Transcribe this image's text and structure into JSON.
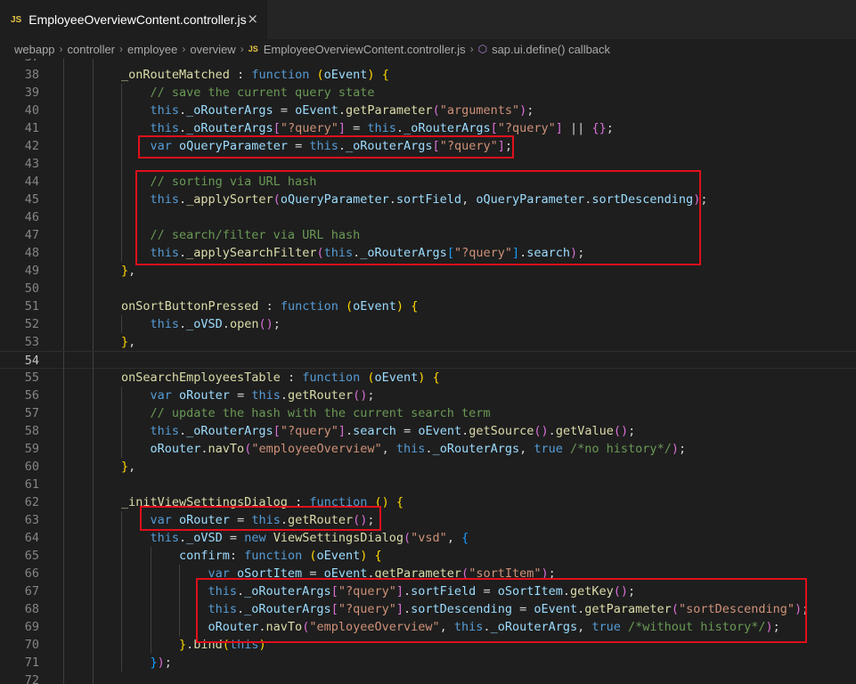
{
  "tab": {
    "badge": "JS",
    "title": "EmployeeOverviewContent.controller.js",
    "close_icon": "×"
  },
  "breadcrumb": {
    "segments": [
      "webapp",
      "controller",
      "employee",
      "overview"
    ],
    "file_badge": "JS",
    "file": "EmployeeOverviewContent.controller.js",
    "symbol": "sap.ui.define() callback"
  },
  "colors": {
    "keyword": "#569cd6",
    "function_name": "#dcdcaa",
    "variable": "#9cdcfe",
    "string": "#ce9178",
    "comment": "#6a9955",
    "highlight_box": "#e00f1c"
  },
  "editor": {
    "lines": [
      {
        "num": "37",
        "indent": 2,
        "tokens": [],
        "partial": true
      },
      {
        "num": "38",
        "indent": 2,
        "tokens": [
          [
            "fn",
            "_onRouteMatched"
          ],
          [
            "p",
            " : "
          ],
          [
            "k",
            "function"
          ],
          [
            "p",
            " "
          ],
          [
            "b1",
            "("
          ],
          [
            "v",
            "oEvent"
          ],
          [
            "b1",
            ")"
          ],
          [
            "p",
            " "
          ],
          [
            "b1",
            "{"
          ]
        ]
      },
      {
        "num": "39",
        "indent": 3,
        "tokens": [
          [
            "c",
            "// save the current query state"
          ]
        ]
      },
      {
        "num": "40",
        "indent": 3,
        "tokens": [
          [
            "k",
            "this"
          ],
          [
            "p",
            "."
          ],
          [
            "v",
            "_oRouterArgs"
          ],
          [
            "p",
            " = "
          ],
          [
            "v",
            "oEvent"
          ],
          [
            "p",
            "."
          ],
          [
            "fn",
            "getParameter"
          ],
          [
            "b2",
            "("
          ],
          [
            "s",
            "\"arguments\""
          ],
          [
            "b2",
            ")"
          ],
          [
            "p",
            ";"
          ]
        ]
      },
      {
        "num": "41",
        "indent": 3,
        "tokens": [
          [
            "k",
            "this"
          ],
          [
            "p",
            "."
          ],
          [
            "v",
            "_oRouterArgs"
          ],
          [
            "b2",
            "["
          ],
          [
            "s",
            "\"?query\""
          ],
          [
            "b2",
            "]"
          ],
          [
            "p",
            " = "
          ],
          [
            "k",
            "this"
          ],
          [
            "p",
            "."
          ],
          [
            "v",
            "_oRouterArgs"
          ],
          [
            "b2",
            "["
          ],
          [
            "s",
            "\"?query\""
          ],
          [
            "b2",
            "]"
          ],
          [
            "p",
            " || "
          ],
          [
            "b2",
            "{}"
          ],
          [
            "p",
            ";"
          ]
        ]
      },
      {
        "num": "42",
        "indent": 3,
        "tokens": [
          [
            "k",
            "var"
          ],
          [
            "p",
            " "
          ],
          [
            "v",
            "oQueryParameter"
          ],
          [
            "p",
            " = "
          ],
          [
            "k",
            "this"
          ],
          [
            "p",
            "."
          ],
          [
            "v",
            "_oRouterArgs"
          ],
          [
            "b2",
            "["
          ],
          [
            "s",
            "\"?query\""
          ],
          [
            "b2",
            "]"
          ],
          [
            "p",
            ";"
          ]
        ]
      },
      {
        "num": "43",
        "indent": 3,
        "tokens": []
      },
      {
        "num": "44",
        "indent": 3,
        "tokens": [
          [
            "c",
            "// sorting via URL hash"
          ]
        ]
      },
      {
        "num": "45",
        "indent": 3,
        "tokens": [
          [
            "k",
            "this"
          ],
          [
            "p",
            "."
          ],
          [
            "fn",
            "_applySorter"
          ],
          [
            "b2",
            "("
          ],
          [
            "v",
            "oQueryParameter"
          ],
          [
            "p",
            "."
          ],
          [
            "v",
            "sortField"
          ],
          [
            "p",
            ", "
          ],
          [
            "v",
            "oQueryParameter"
          ],
          [
            "p",
            "."
          ],
          [
            "v",
            "sortDescending"
          ],
          [
            "b2",
            ")"
          ],
          [
            "p",
            ";"
          ]
        ]
      },
      {
        "num": "46",
        "indent": 3,
        "tokens": []
      },
      {
        "num": "47",
        "indent": 3,
        "tokens": [
          [
            "c",
            "// search/filter via URL hash"
          ]
        ]
      },
      {
        "num": "48",
        "indent": 3,
        "tokens": [
          [
            "k",
            "this"
          ],
          [
            "p",
            "."
          ],
          [
            "fn",
            "_applySearchFilter"
          ],
          [
            "b2",
            "("
          ],
          [
            "k",
            "this"
          ],
          [
            "p",
            "."
          ],
          [
            "v",
            "_oRouterArgs"
          ],
          [
            "b3",
            "["
          ],
          [
            "s",
            "\"?query\""
          ],
          [
            "b3",
            "]"
          ],
          [
            "p",
            "."
          ],
          [
            "v",
            "search"
          ],
          [
            "b2",
            ")"
          ],
          [
            "p",
            ";"
          ]
        ]
      },
      {
        "num": "49",
        "indent": 2,
        "tokens": [
          [
            "b1",
            "}"
          ],
          [
            "p",
            ","
          ]
        ]
      },
      {
        "num": "50",
        "indent": 2,
        "tokens": []
      },
      {
        "num": "51",
        "indent": 2,
        "tokens": [
          [
            "fn",
            "onSortButtonPressed"
          ],
          [
            "p",
            " : "
          ],
          [
            "k",
            "function"
          ],
          [
            "p",
            " "
          ],
          [
            "b1",
            "("
          ],
          [
            "v",
            "oEvent"
          ],
          [
            "b1",
            ")"
          ],
          [
            "p",
            " "
          ],
          [
            "b1",
            "{"
          ]
        ]
      },
      {
        "num": "52",
        "indent": 3,
        "tokens": [
          [
            "k",
            "this"
          ],
          [
            "p",
            "."
          ],
          [
            "v",
            "_oVSD"
          ],
          [
            "p",
            "."
          ],
          [
            "fn",
            "open"
          ],
          [
            "b2",
            "()"
          ],
          [
            "p",
            ";"
          ]
        ]
      },
      {
        "num": "53",
        "indent": 2,
        "tokens": [
          [
            "b1",
            "}"
          ],
          [
            "p",
            ","
          ]
        ]
      },
      {
        "num": "54",
        "indent": 2,
        "tokens": [],
        "current": true
      },
      {
        "num": "55",
        "indent": 2,
        "tokens": [
          [
            "fn",
            "onSearchEmployeesTable"
          ],
          [
            "p",
            " : "
          ],
          [
            "k",
            "function"
          ],
          [
            "p",
            " "
          ],
          [
            "b1",
            "("
          ],
          [
            "v",
            "oEvent"
          ],
          [
            "b1",
            ")"
          ],
          [
            "p",
            " "
          ],
          [
            "b1",
            "{"
          ]
        ]
      },
      {
        "num": "56",
        "indent": 3,
        "tokens": [
          [
            "k",
            "var"
          ],
          [
            "p",
            " "
          ],
          [
            "v",
            "oRouter"
          ],
          [
            "p",
            " = "
          ],
          [
            "k",
            "this"
          ],
          [
            "p",
            "."
          ],
          [
            "fn",
            "getRouter"
          ],
          [
            "b2",
            "()"
          ],
          [
            "p",
            ";"
          ]
        ]
      },
      {
        "num": "57",
        "indent": 3,
        "tokens": [
          [
            "c",
            "// update the hash with the current search term"
          ]
        ]
      },
      {
        "num": "58",
        "indent": 3,
        "tokens": [
          [
            "k",
            "this"
          ],
          [
            "p",
            "."
          ],
          [
            "v",
            "_oRouterArgs"
          ],
          [
            "b2",
            "["
          ],
          [
            "s",
            "\"?query\""
          ],
          [
            "b2",
            "]"
          ],
          [
            "p",
            "."
          ],
          [
            "v",
            "search"
          ],
          [
            "p",
            " = "
          ],
          [
            "v",
            "oEvent"
          ],
          [
            "p",
            "."
          ],
          [
            "fn",
            "getSource"
          ],
          [
            "b2",
            "()"
          ],
          [
            "p",
            "."
          ],
          [
            "fn",
            "getValue"
          ],
          [
            "b2",
            "()"
          ],
          [
            "p",
            ";"
          ]
        ]
      },
      {
        "num": "59",
        "indent": 3,
        "tokens": [
          [
            "v",
            "oRouter"
          ],
          [
            "p",
            "."
          ],
          [
            "fn",
            "navTo"
          ],
          [
            "b2",
            "("
          ],
          [
            "s",
            "\"employeeOverview\""
          ],
          [
            "p",
            ", "
          ],
          [
            "k",
            "this"
          ],
          [
            "p",
            "."
          ],
          [
            "v",
            "_oRouterArgs"
          ],
          [
            "p",
            ", "
          ],
          [
            "k",
            "true"
          ],
          [
            "p",
            " "
          ],
          [
            "c",
            "/*no history*/"
          ],
          [
            "b2",
            ")"
          ],
          [
            "p",
            ";"
          ]
        ]
      },
      {
        "num": "60",
        "indent": 2,
        "tokens": [
          [
            "b1",
            "}"
          ],
          [
            "p",
            ","
          ]
        ]
      },
      {
        "num": "61",
        "indent": 2,
        "tokens": []
      },
      {
        "num": "62",
        "indent": 2,
        "tokens": [
          [
            "fn",
            "_initViewSettingsDialog"
          ],
          [
            "p",
            " : "
          ],
          [
            "k",
            "function"
          ],
          [
            "p",
            " "
          ],
          [
            "b1",
            "()"
          ],
          [
            "p",
            " "
          ],
          [
            "b1",
            "{"
          ]
        ]
      },
      {
        "num": "63",
        "indent": 3,
        "tokens": [
          [
            "k",
            "var"
          ],
          [
            "p",
            " "
          ],
          [
            "v",
            "oRouter"
          ],
          [
            "p",
            " = "
          ],
          [
            "k",
            "this"
          ],
          [
            "p",
            "."
          ],
          [
            "fn",
            "getRouter"
          ],
          [
            "b2",
            "()"
          ],
          [
            "p",
            ";"
          ]
        ]
      },
      {
        "num": "64",
        "indent": 3,
        "tokens": [
          [
            "k",
            "this"
          ],
          [
            "p",
            "."
          ],
          [
            "v",
            "_oVSD"
          ],
          [
            "p",
            " = "
          ],
          [
            "k",
            "new"
          ],
          [
            "p",
            " "
          ],
          [
            "fn",
            "ViewSettingsDialog"
          ],
          [
            "b2",
            "("
          ],
          [
            "s",
            "\"vsd\""
          ],
          [
            "p",
            ", "
          ],
          [
            "b3",
            "{"
          ]
        ]
      },
      {
        "num": "65",
        "indent": 4,
        "tokens": [
          [
            "v",
            "confirm"
          ],
          [
            "p",
            ": "
          ],
          [
            "k",
            "function"
          ],
          [
            "p",
            " "
          ],
          [
            "b1",
            "("
          ],
          [
            "v",
            "oEvent"
          ],
          [
            "b1",
            ")"
          ],
          [
            "p",
            " "
          ],
          [
            "b1",
            "{"
          ]
        ]
      },
      {
        "num": "66",
        "indent": 5,
        "tokens": [
          [
            "k",
            "var"
          ],
          [
            "p",
            " "
          ],
          [
            "v",
            "oSortItem"
          ],
          [
            "p",
            " = "
          ],
          [
            "v",
            "oEvent"
          ],
          [
            "p",
            "."
          ],
          [
            "fn",
            "getParameter"
          ],
          [
            "b2",
            "("
          ],
          [
            "s",
            "\"sortItem\""
          ],
          [
            "b2",
            ")"
          ],
          [
            "p",
            ";"
          ]
        ]
      },
      {
        "num": "67",
        "indent": 5,
        "tokens": [
          [
            "k",
            "this"
          ],
          [
            "p",
            "."
          ],
          [
            "v",
            "_oRouterArgs"
          ],
          [
            "b2",
            "["
          ],
          [
            "s",
            "\"?query\""
          ],
          [
            "b2",
            "]"
          ],
          [
            "p",
            "."
          ],
          [
            "v",
            "sortField"
          ],
          [
            "p",
            " = "
          ],
          [
            "v",
            "oSortItem"
          ],
          [
            "p",
            "."
          ],
          [
            "fn",
            "getKey"
          ],
          [
            "b2",
            "()"
          ],
          [
            "p",
            ";"
          ]
        ]
      },
      {
        "num": "68",
        "indent": 5,
        "tokens": [
          [
            "k",
            "this"
          ],
          [
            "p",
            "."
          ],
          [
            "v",
            "_oRouterArgs"
          ],
          [
            "b2",
            "["
          ],
          [
            "s",
            "\"?query\""
          ],
          [
            "b2",
            "]"
          ],
          [
            "p",
            "."
          ],
          [
            "v",
            "sortDescending"
          ],
          [
            "p",
            " = "
          ],
          [
            "v",
            "oEvent"
          ],
          [
            "p",
            "."
          ],
          [
            "fn",
            "getParameter"
          ],
          [
            "b2",
            "("
          ],
          [
            "s",
            "\"sortDescending\""
          ],
          [
            "b2",
            ")"
          ],
          [
            "p",
            ";"
          ]
        ]
      },
      {
        "num": "69",
        "indent": 5,
        "tokens": [
          [
            "v",
            "oRouter"
          ],
          [
            "p",
            "."
          ],
          [
            "fn",
            "navTo"
          ],
          [
            "b2",
            "("
          ],
          [
            "s",
            "\"employeeOverview\""
          ],
          [
            "p",
            ", "
          ],
          [
            "k",
            "this"
          ],
          [
            "p",
            "."
          ],
          [
            "v",
            "_oRouterArgs"
          ],
          [
            "p",
            ", "
          ],
          [
            "k",
            "true"
          ],
          [
            "p",
            " "
          ],
          [
            "c",
            "/*without history*/"
          ],
          [
            "b2",
            ")"
          ],
          [
            "p",
            ";"
          ]
        ]
      },
      {
        "num": "70",
        "indent": 4,
        "tokens": [
          [
            "b1",
            "}"
          ],
          [
            "p",
            "."
          ],
          [
            "fn",
            "bind"
          ],
          [
            "b1",
            "("
          ],
          [
            "k",
            "this"
          ],
          [
            "b1",
            ")"
          ]
        ]
      },
      {
        "num": "71",
        "indent": 3,
        "tokens": [
          [
            "b3",
            "}"
          ],
          [
            "b2",
            ")"
          ],
          [
            "p",
            ";"
          ]
        ]
      },
      {
        "num": "72",
        "indent": 2,
        "tokens": [],
        "partial": true
      }
    ]
  },
  "highlights": [
    "line-42-box",
    "lines-44-48-box",
    "line-63-box",
    "lines-67-69-box"
  ]
}
